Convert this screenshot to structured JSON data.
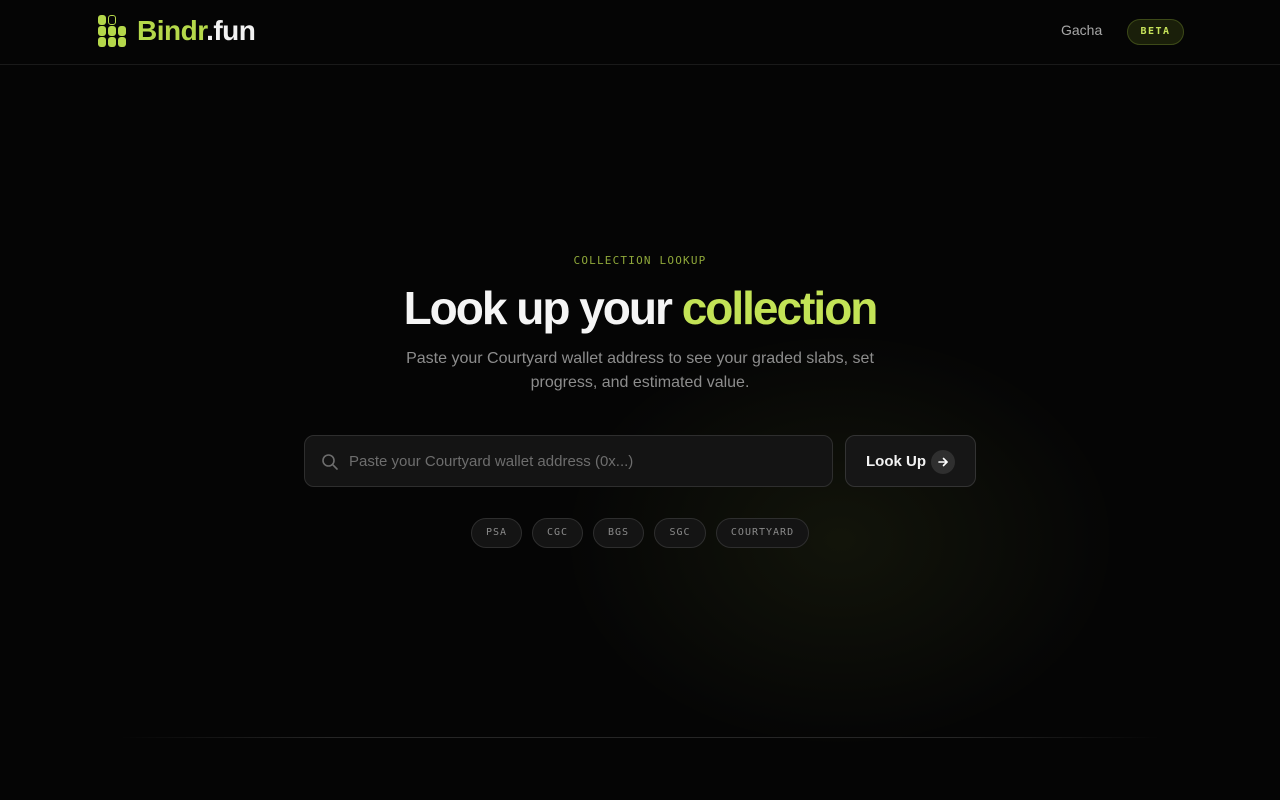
{
  "header": {
    "logo_primary": "Bindr",
    "logo_secondary": ".fun",
    "nav_gacha": "Gacha",
    "beta_badge": "BETA"
  },
  "hero": {
    "eyebrow": "COLLECTION LOOKUP",
    "title_main": "Look up your ",
    "title_accent": "collection",
    "subtitle": "Paste your Courtyard wallet address to see your graded slabs, set progress, and estimated value."
  },
  "search": {
    "placeholder": "Paste your Courtyard wallet address (0x...)",
    "value": "",
    "button_label": "Look Up"
  },
  "chips": [
    "PSA",
    "CGC",
    "BGS",
    "SGC",
    "COURTYARD"
  ],
  "colors": {
    "accent": "#c3e356",
    "background": "#050505"
  },
  "icons": {
    "logo": "grid-logo-icon",
    "search": "search-icon",
    "button": "arrow-right-icon"
  }
}
